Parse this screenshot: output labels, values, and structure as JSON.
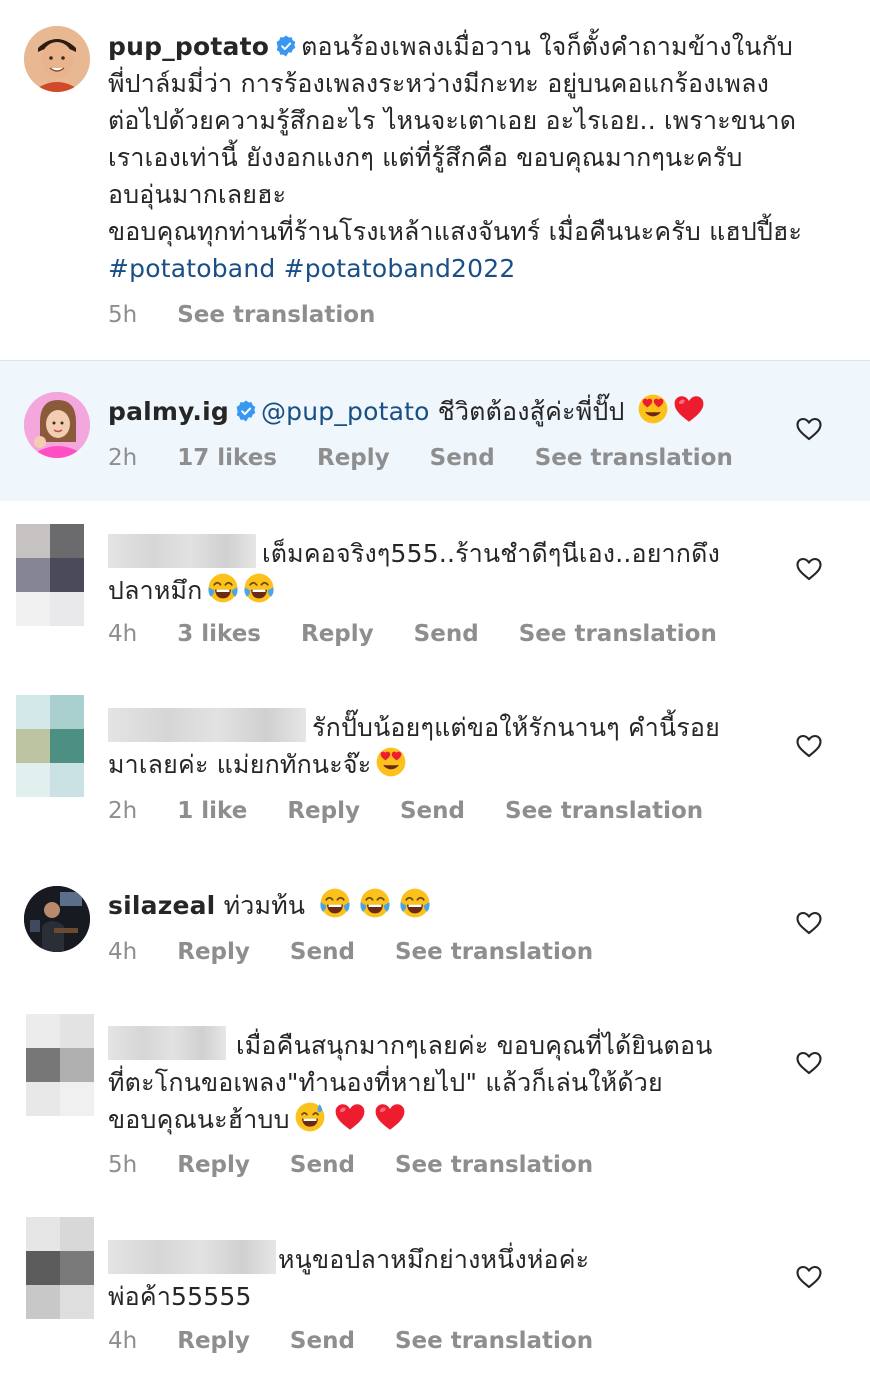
{
  "comments": [
    {
      "username": "pup_potato",
      "verified": true,
      "lines": [
        "ตอนร้องเพลงเมื่อวาน ใจก็ตั้งคำถามข้างในกับ",
        "พี่ปาล์มมี่ว่า การร้องเพลงระหว่างมีกะทะ อยู่บนคอแกร้องเพลง",
        "ต่อไปด้วยความรู้สึกอะไร ไหนจะเตาเอย อะไรเอย.. เพราะขนาด",
        "เราเองเท่านี้ ยังงอกแงกๆ แต่ที่รู้สึกคือ ขอบคุณมากๆนะครับ",
        "อบอุ่นมากเลยฮะ",
        "ขอบคุณทุกท่านที่ร้านโรงเหล้าแสงจันทร์ เมื่อคืนนะครับ แฮปปี้ฮะ"
      ],
      "hashtags": "#potatoband #potatoband2022",
      "time": "5h",
      "see_translation": "See translation"
    },
    {
      "username": "palmy.ig",
      "verified": true,
      "mention": "@pup_potato",
      "text": "ชีวิตต้องสู้ค่ะพี่ปั๊ป",
      "time": "2h",
      "likes": "17 likes",
      "reply": "Reply",
      "send": "Send",
      "see_translation": "See translation"
    },
    {
      "line1": "เต็มคอจริงๆ555..ร้านชำดีๆนีเอง..อยากดึง",
      "line2": "ปลาหมึก",
      "time": "4h",
      "likes": "3 likes",
      "reply": "Reply",
      "send": "Send",
      "see_translation": "See translation"
    },
    {
      "line1": "รักปั๊บน้อยๆแต่ขอให้รักนานๆ  คำนี้รอย",
      "line2": "มาเลยค่ะ แม่ยกทักนะจ๊ะ",
      "time": "2h",
      "likes": "1 like",
      "reply": "Reply",
      "send": "Send",
      "see_translation": "See translation"
    },
    {
      "username": "silazeal",
      "text": "ท่วมท้น",
      "time": "4h",
      "reply": "Reply",
      "send": "Send",
      "see_translation": "See translation"
    },
    {
      "line1": "เมื่อคืนสนุกมากๆเลยค่ะ ขอบคุณที่ได้ยินตอน",
      "line2": "ที่ตะโกนขอเพลง\"ทำนองที่หายไป\" แล้วก็เล่นให้ด้วย",
      "line3": "ขอบคุณนะฮ้าบบ",
      "time": "5h",
      "reply": "Reply",
      "send": "Send",
      "see_translation": "See translation"
    },
    {
      "line1": "หนูขอปลาหมึกย่างหนึ่งห่อค่ะ",
      "line2": "พ่อค้า55555",
      "time": "4h",
      "reply": "Reply",
      "send": "Send",
      "see_translation": "See translation"
    }
  ],
  "colors": {
    "highlight_bg": "#eff6fc",
    "link": "#1a4f86",
    "muted": "#8e8e8e",
    "verified": "#3897f0",
    "heart_red": "#ed1c2e"
  },
  "icons": {
    "verified": "verified-badge-icon",
    "like": "heart-outline-icon",
    "emoji_laugh": "face-with-tears-of-joy-emoji",
    "emoji_love": "smiling-face-with-heart-eyes-emoji",
    "emoji_sweat": "grinning-face-with-sweat-emoji",
    "emoji_heart": "red-heart-emoji"
  }
}
